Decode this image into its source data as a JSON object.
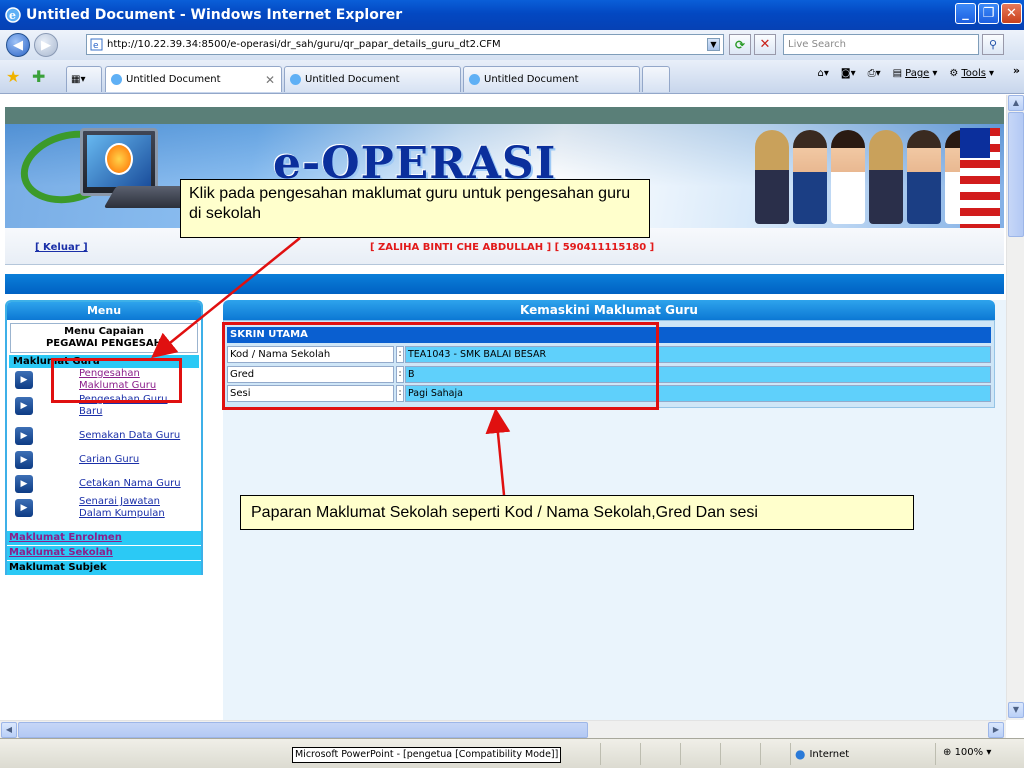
{
  "window": {
    "title": "Untitled Document - Windows Internet Explorer"
  },
  "browser": {
    "url": "http://10.22.39.34:8500/e-operasi/dr_sah/guru/qr_papar_details_guru_dt2.CFM",
    "search_placeholder": "Live Search",
    "tabs": [
      {
        "label": "Untitled Document"
      },
      {
        "label": "Untitled Document"
      },
      {
        "label": "Untitled Document"
      }
    ],
    "toolbar": {
      "page_label": "Page",
      "tools_label": "Tools"
    }
  },
  "page": {
    "logo": "e-OPERASI",
    "logout": "[ Keluar ]",
    "user": "[ ZALIHA BINTI CHE ABDULLAH ]  [ 590411115180 ]",
    "menu": {
      "title": "Menu",
      "caption_line1": "Menu Capaian",
      "caption_line2": "PEGAWAI PENGESAH",
      "group": "Maklumat Guru",
      "items": [
        {
          "label": "Pengesahan Maklumat Guru"
        },
        {
          "label": "Pengesahan Guru Baru"
        },
        {
          "label": "Semakan Data Guru"
        },
        {
          "label": "Carian Guru"
        },
        {
          "label": "Cetakan Nama Guru"
        },
        {
          "label": "Senarai Jawatan Dalam Kumpulan"
        }
      ],
      "bottom": [
        {
          "label": "Maklumat Enrolmen"
        },
        {
          "label": "Maklumat Sekolah"
        },
        {
          "label": "Maklumat Subjek"
        }
      ]
    },
    "panel": {
      "title": "Kemaskini Maklumat Guru",
      "section": "SKRIN UTAMA",
      "rows": [
        {
          "label": "Kod / Nama Sekolah",
          "sep": ":",
          "value": "TEA1043 - SMK BALAI BESAR"
        },
        {
          "label": "Gred",
          "sep": ":",
          "value": "B"
        },
        {
          "label": "Sesi",
          "sep": ":",
          "value": "Pagi Sahaja"
        }
      ]
    }
  },
  "annotations": {
    "callout1": "Klik pada pengesahan  maklumat guru untuk pengesahan guru di sekolah",
    "callout2": "Paparan Maklumat Sekolah seperti  Kod / Nama Sekolah,Gred Dan sesi",
    "color": "#e01010"
  },
  "status": {
    "taskbar_item": "Microsoft PowerPoint - [pengetua [Compatibility Mode]]",
    "zone": "Internet",
    "zoom": "100%"
  },
  "colors": {
    "title_bar": "#0348c2",
    "menu_head": "#0c78d4",
    "cyan_row": "#5fd0fb",
    "skrin": "#0a5fd0"
  }
}
